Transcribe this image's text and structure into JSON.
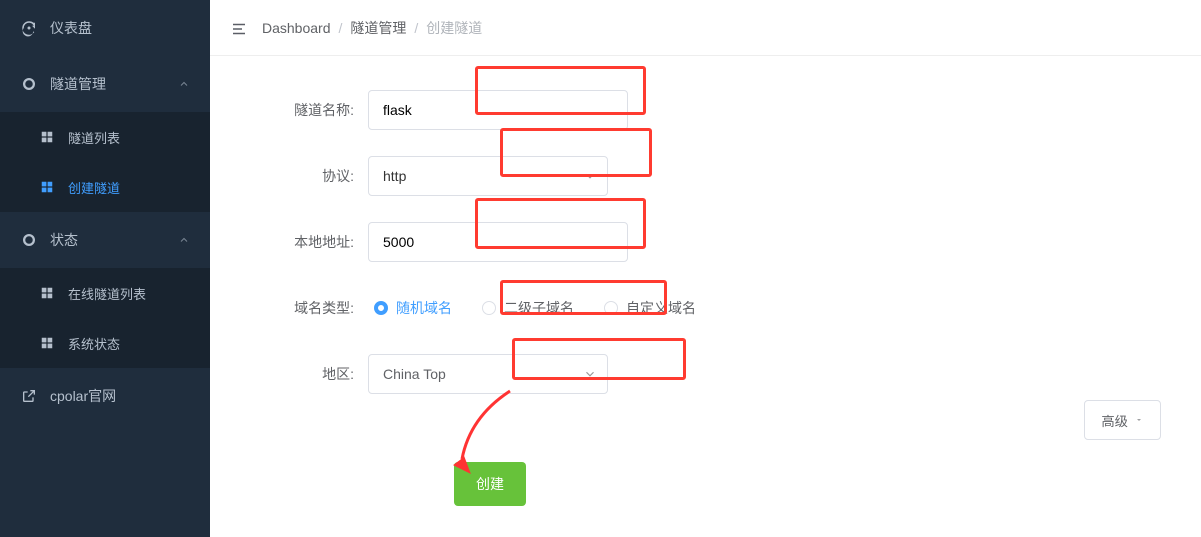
{
  "sidebar": {
    "dashboard": "仪表盘",
    "tunnel_manage": "隧道管理",
    "tunnel_list": "隧道列表",
    "create_tunnel": "创建隧道",
    "status": "状态",
    "online_tunnels": "在线隧道列表",
    "system_status": "系统状态",
    "cpolar_site": "cpolar官网"
  },
  "breadcrumb": {
    "a": "Dashboard",
    "b": "隧道管理",
    "c": "创建隧道"
  },
  "form": {
    "name_label": "隧道名称:",
    "name_value": "flask",
    "protocol_label": "协议:",
    "protocol_value": "http",
    "local_addr_label": "本地地址:",
    "local_addr_value": "5000",
    "domain_type_label": "域名类型:",
    "domain_opts": {
      "random": "随机域名",
      "sub": "二级子域名",
      "custom": "自定义域名"
    },
    "region_label": "地区:",
    "region_value": "China Top",
    "advanced": "高级",
    "submit": "创建"
  }
}
